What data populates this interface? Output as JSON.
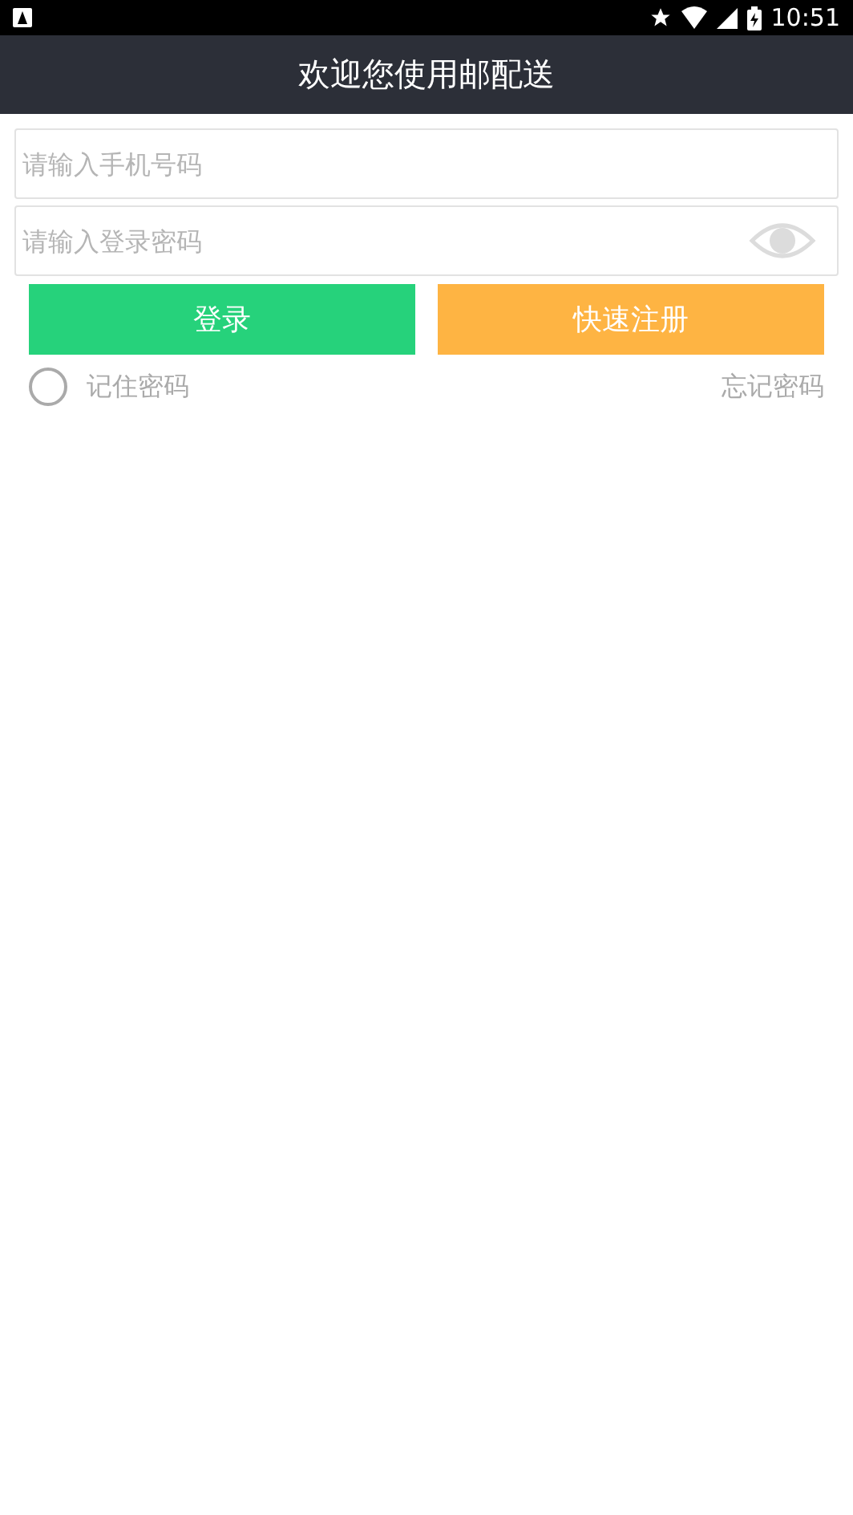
{
  "status_bar": {
    "time": "10:51"
  },
  "header": {
    "title": "欢迎您使用邮配送"
  },
  "phone_field": {
    "placeholder": "请输入手机号码"
  },
  "password_field": {
    "placeholder": "请输入登录密码"
  },
  "buttons": [
    {
      "label": "登录",
      "kind": "login"
    },
    {
      "label": "快速注册",
      "kind": "register"
    }
  ],
  "remember": {
    "label": "记住密码",
    "checked": false
  },
  "forgot_link": "忘记密码"
}
